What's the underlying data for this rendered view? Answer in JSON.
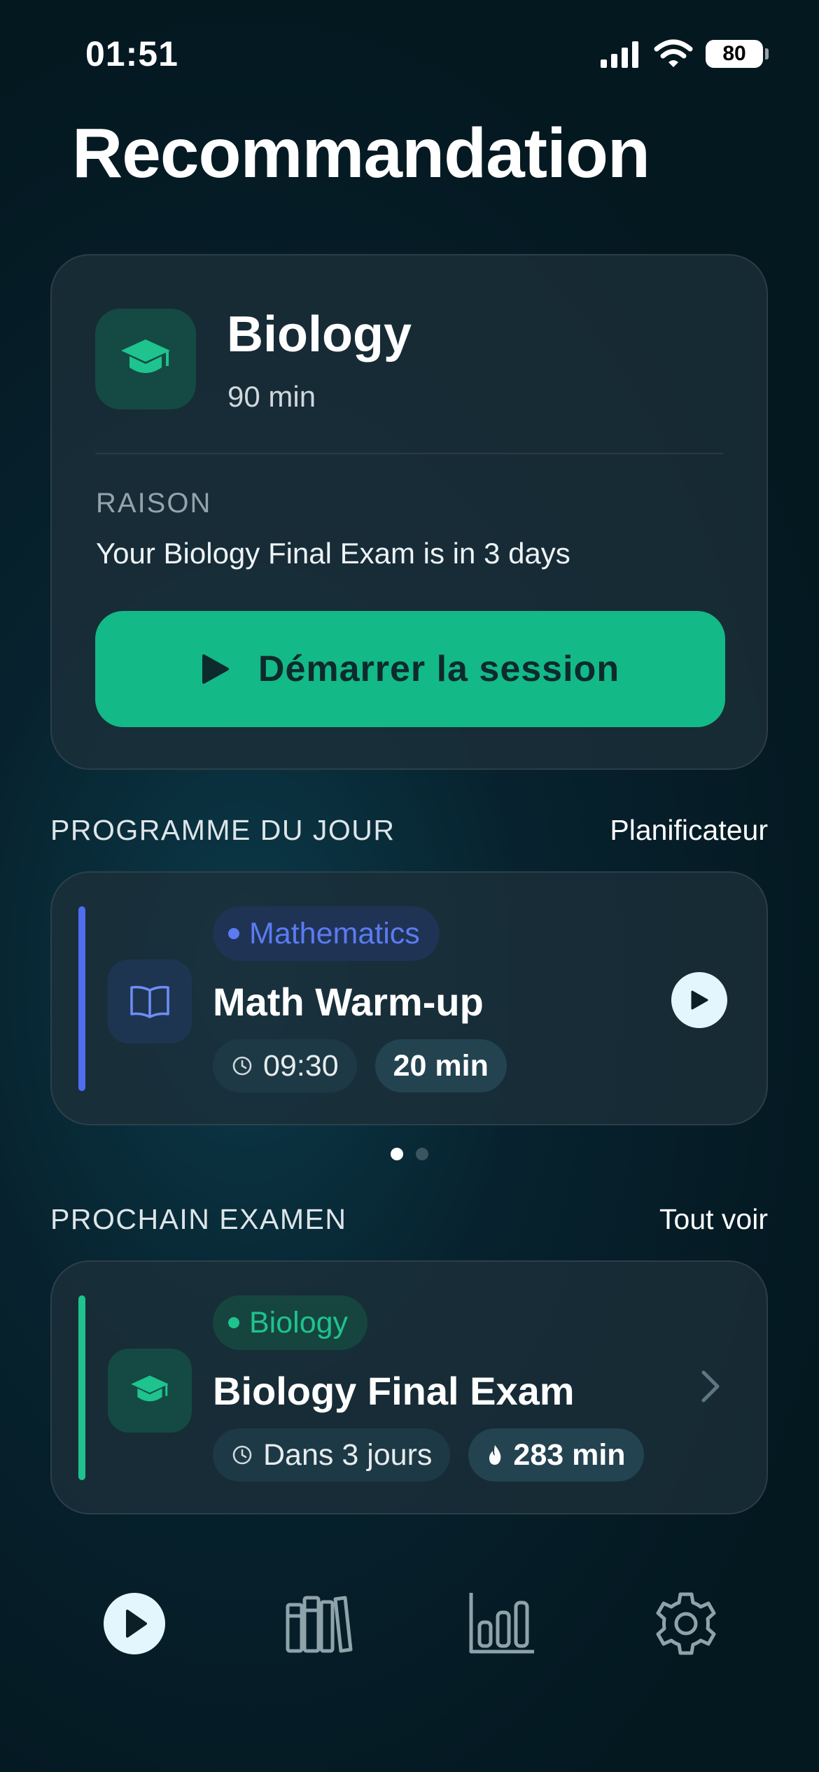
{
  "status_bar": {
    "time": "01:51",
    "battery": "80"
  },
  "page_title": "Recommandation",
  "recommendation": {
    "subject": "Biology",
    "duration": "90 min",
    "reason_label": "RAISON",
    "reason": "Your Biology Final Exam is in 3 days",
    "start_button": "Démarrer la session"
  },
  "today": {
    "title": "PROGRAMME DU JOUR",
    "link": "Planificateur",
    "item": {
      "tag": "Mathematics",
      "title": "Math Warm-up",
      "time": "09:30",
      "duration": "20 min"
    }
  },
  "exam": {
    "title": "PROCHAIN EXAMEN",
    "link": "Tout voir",
    "item": {
      "tag": "Biology",
      "title": "Biology Final Exam",
      "countdown": "Dans 3 jours",
      "minutes": "283 min"
    }
  },
  "colors": {
    "accent_green": "#13b987",
    "math_blue": "#4f6df0",
    "biology_green": "#1ec38e"
  },
  "nav": {
    "items": [
      "play-icon",
      "library-icon",
      "stats-icon",
      "settings-icon"
    ],
    "active": "play-icon"
  }
}
